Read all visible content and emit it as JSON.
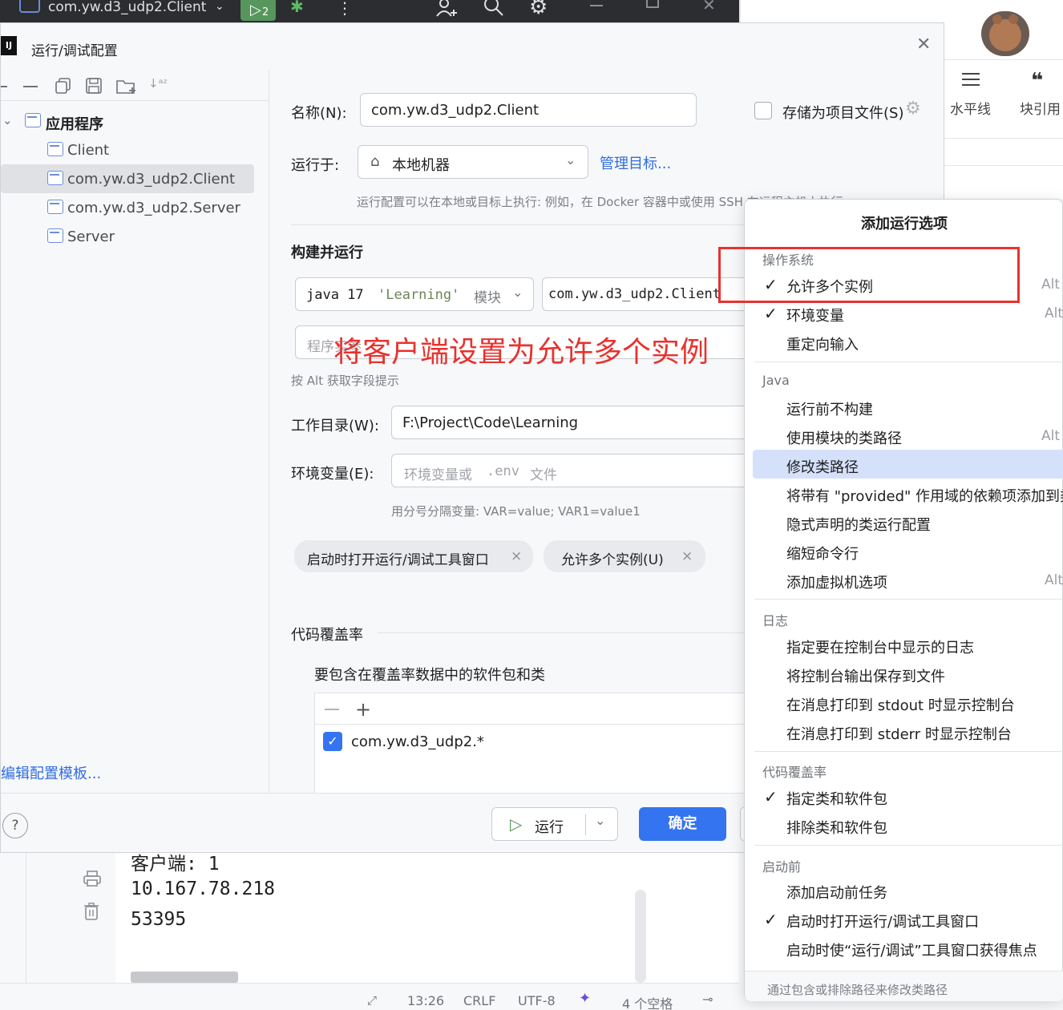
{
  "ide": {
    "project_title": "com.yw.d3_udp2.Client",
    "run_badge": "2"
  },
  "bg_app": {
    "tool_hr": "水平线",
    "tool_quote": "块引用",
    "quote_glyph": "❝"
  },
  "dialog": {
    "title": "运行/调试配置",
    "tree": {
      "group": "应用程序",
      "items": [
        "Client",
        "com.yw.d3_udp2.Client",
        "com.yw.d3_udp2.Server",
        "Server"
      ],
      "selected_index": 1
    },
    "edit_templates": "编辑配置模板...",
    "name_label": "名称(N):",
    "name_value": "com.yw.d3_udp2.Client",
    "store_as_project_file": "存储为项目文件(S)",
    "run_on_label": "运行于:",
    "run_on_value": "本地机器",
    "manage_targets": "管理目标...",
    "run_on_hint": "运行配置可以在本地或目标上执行: 例如，在 Docker 容器中或使用 SSH 在远程主机上执行。",
    "build_and_run": "构建并运行",
    "jdk_value": "java 17",
    "jdk_module": "'Learning'",
    "jdk_suffix": "模块",
    "main_class_value": "com.yw.d3_udp2.Client",
    "program_args_placeholder": "程序实参",
    "alt_hint": "按 Alt 获取字段提示",
    "workdir_label": "工作目录(W):",
    "workdir_value": "F:\\Project\\Code\\Learning",
    "env_label": "环境变量(E):",
    "env_placeholder_a": "环境变量或",
    "env_placeholder_b": ".env",
    "env_placeholder_c": "文件",
    "env_hint": "用分号分隔变量: VAR=value; VAR1=value1",
    "chips": [
      "启动时打开运行/调试工具窗口",
      "允许多个实例(U)"
    ],
    "chip_close": "×",
    "coverage_title": "代码覆盖率",
    "coverage_sub": "要包含在覆盖率数据中的软件包和类",
    "coverage_item": "com.yw.d3_udp2.*",
    "run_button": "运行",
    "ok_button": "确定",
    "help": "?"
  },
  "annotation": {
    "text": "将客户端设置为允许多个实例",
    "color": "#e8322e"
  },
  "popup": {
    "title": "添加运行选项",
    "sections": [
      {
        "header": "操作系统",
        "items": [
          {
            "label": "允许多个实例",
            "checked": true,
            "shortcut": "Alt"
          },
          {
            "label": "环境变量",
            "checked": true,
            "shortcut": "Alt"
          },
          {
            "label": "重定向输入",
            "checked": false,
            "shortcut": ""
          }
        ]
      },
      {
        "header": "Java",
        "items": [
          {
            "label": "运行前不构建",
            "checked": false,
            "shortcut": ""
          },
          {
            "label": "使用模块的类路径",
            "checked": false,
            "shortcut": "Alt"
          },
          {
            "label": "修改类路径",
            "checked": false,
            "shortcut": "",
            "highlight": true
          },
          {
            "label": "将带有 \"provided\" 作用域的依赖项添加到类",
            "checked": false,
            "shortcut": ""
          },
          {
            "label": "隐式声明的类运行配置",
            "checked": false,
            "shortcut": ""
          },
          {
            "label": "缩短命令行",
            "checked": false,
            "shortcut": ""
          },
          {
            "label": "添加虚拟机选项",
            "checked": false,
            "shortcut": "Alt"
          }
        ]
      },
      {
        "header": "日志",
        "items": [
          {
            "label": "指定要在控制台中显示的日志",
            "checked": false,
            "shortcut": ""
          },
          {
            "label": "将控制台输出保存到文件",
            "checked": false,
            "shortcut": ""
          },
          {
            "label": "在消息打印到 stdout 时显示控制台",
            "checked": false,
            "shortcut": ""
          },
          {
            "label": "在消息打印到 stderr 时显示控制台",
            "checked": false,
            "shortcut": ""
          }
        ]
      },
      {
        "header": "代码覆盖率",
        "items": [
          {
            "label": "指定类和软件包",
            "checked": true,
            "shortcut": ""
          },
          {
            "label": "排除类和软件包",
            "checked": false,
            "shortcut": ""
          }
        ]
      },
      {
        "header": "启动前",
        "items": [
          {
            "label": "添加启动前任务",
            "checked": false,
            "shortcut": ""
          },
          {
            "label": "启动时打开运行/调试工具窗口",
            "checked": true,
            "shortcut": ""
          },
          {
            "label": "启动时使“运行/调试”工具窗口获得焦点",
            "checked": false,
            "shortcut": ""
          }
        ]
      }
    ],
    "footer": "通过包含或排除路径来修改类路径",
    "check_glyph": "✓"
  },
  "console": {
    "line1": "客户端: 1",
    "line2": "10.167.78.218",
    "line3": "53395"
  },
  "statusbar": {
    "position": "13:26",
    "line_sep": "CRLF",
    "encoding": "UTF-8",
    "indent": "4 个空格"
  }
}
